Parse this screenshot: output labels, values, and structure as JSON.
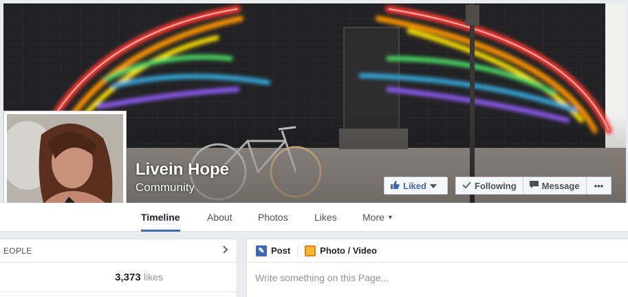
{
  "page": {
    "name": "Livein Hope",
    "category": "Community"
  },
  "actions": {
    "liked": "Liked",
    "following": "Following",
    "message": "Message",
    "more": "•••"
  },
  "nav": {
    "tabs": [
      "Timeline",
      "About",
      "Photos",
      "Likes",
      "More"
    ]
  },
  "people_card": {
    "header": "EOPLE",
    "likes_count": "3,373",
    "likes_label": "likes"
  },
  "composer": {
    "tabs": [
      "Post",
      "Photo / Video"
    ],
    "placeholder": "Write something on this Page..."
  },
  "icons": [
    "thumbs-up-icon",
    "caret-down-icon",
    "checkmark-icon",
    "message-icon",
    "chevron-right-icon",
    "pencil-icon",
    "photo-icon"
  ],
  "colors": {
    "brand": "#4267b2",
    "nav_background": "#ffffff",
    "page_background": "#e9ebee"
  }
}
